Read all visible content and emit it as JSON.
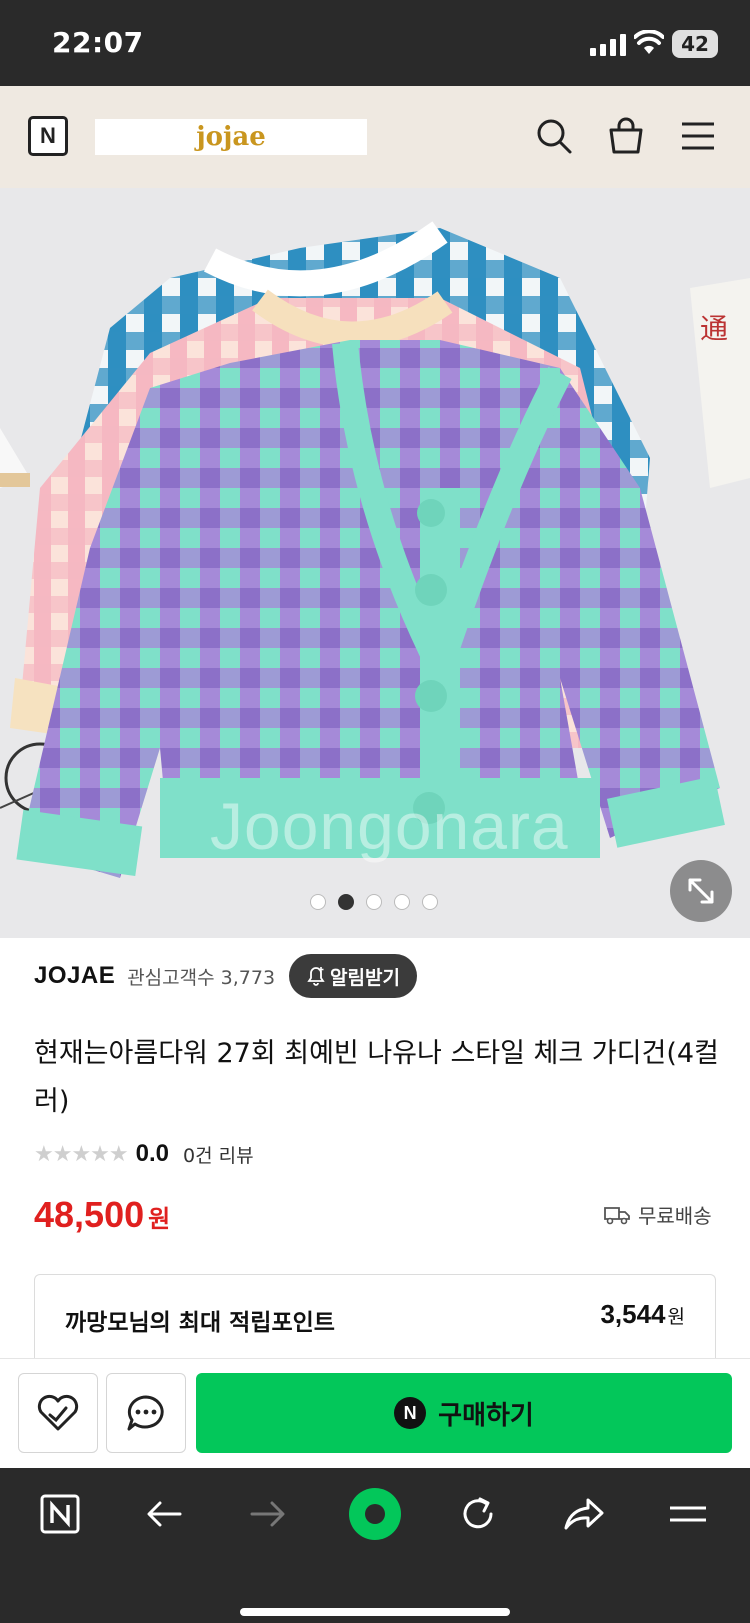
{
  "status_bar": {
    "time": "22:07",
    "battery": "42"
  },
  "header": {
    "logo": "N",
    "brand": "jojae"
  },
  "image": {
    "watermark": "Joongonara",
    "slide_count": 5,
    "active_slide": 2
  },
  "product": {
    "seller": "JOJAE",
    "fans_label": "관심고객수 3,773",
    "alarm_label": "알림받기",
    "title": "현재는아름다워 27회 최예빈 나유나 스타일 체크 가디건(4컬러)",
    "rating_score": "0.0",
    "review_count": "0건 리뷰",
    "price": "48,500",
    "price_unit": "원",
    "shipping": "무료배송"
  },
  "points": {
    "label": "까망모님의 최대 적립포인트",
    "value": "3,544",
    "unit": "원"
  },
  "actions": {
    "buy_label": "구매하기",
    "buy_badge": "N"
  },
  "colors": {
    "buy_green": "#03c75a",
    "price_red": "#e0201f",
    "header_bg": "#efe9e1",
    "brand_gold": "#c9961f"
  }
}
